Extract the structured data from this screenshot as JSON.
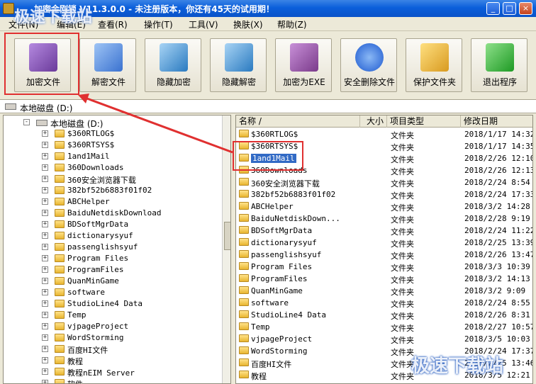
{
  "window": {
    "title": "加密金刚锁 V11.3.0.0 - 未注册版本，你还有45天的试用期！",
    "controls": [
      "_",
      "□",
      "×"
    ]
  },
  "menu": [
    "文件(N)",
    "编辑(E)",
    "查看(R)",
    "操作(T)",
    "工具(V)",
    "换肤(X)",
    "帮助(Z)"
  ],
  "toolbar": [
    {
      "label": "加密文件",
      "icon": "encrypt-book-icon",
      "color": "#7a4fb0"
    },
    {
      "label": "解密文件",
      "icon": "decrypt-key-icon",
      "color": "#4a7fd8"
    },
    {
      "label": "隐藏加密",
      "icon": "hide-lock-icon",
      "color": "#3a8ad0"
    },
    {
      "label": "隐藏解密",
      "icon": "unhide-key-icon",
      "color": "#3a8ad0"
    },
    {
      "label": "加密为EXE",
      "icon": "exe-lock-icon",
      "color": "#8a4a9a"
    },
    {
      "label": "安全删除文件",
      "icon": "delete-x-icon",
      "color": "#2a6ad8"
    },
    {
      "label": "保护文件夹",
      "icon": "protect-folder-icon",
      "color": "#d8a020"
    },
    {
      "label": "退出程序",
      "icon": "exit-arrow-icon",
      "color": "#2aa02a"
    }
  ],
  "address": "本地磁盘 (D:)",
  "tree": {
    "root": "本地磁盘 (D:)",
    "items": [
      "$360RTLOG$",
      "$360RTSYS$",
      "1and1Mail",
      "360Downloads",
      "360安全浏览器下载",
      "382bf52b6883f01f02",
      "ABCHelper",
      "BaiduNetdiskDownload",
      "BDSoftMgrData",
      "dictionarysyuf",
      "passenglishsyuf",
      "Program Files",
      "ProgramFiles",
      "QuanMinGame",
      "software",
      "StudioLine4 Data",
      "Temp",
      "vjpageProject",
      "WordStorming",
      "百度HI文件",
      "教程",
      "教程nEIM Server",
      "软件"
    ]
  },
  "list": {
    "columns": [
      "名称 /",
      "大小",
      "项目类型",
      "修改日期"
    ],
    "rows": [
      {
        "name": "$360RTLOG$",
        "type": "文件夹",
        "date": "2018/1/17 14:32"
      },
      {
        "name": "$360RTSYS$",
        "type": "文件夹",
        "date": "2018/1/17 14:35"
      },
      {
        "name": "1and1Mail",
        "type": "文件夹",
        "date": "2018/2/26 12:10"
      },
      {
        "name": "360Downloads",
        "type": "文件夹",
        "date": "2018/2/26 12:13"
      },
      {
        "name": "360安全浏览器下载",
        "type": "文件夹",
        "date": "2018/2/24 8:54"
      },
      {
        "name": "382bf52b6883f01f02",
        "type": "文件夹",
        "date": "2018/2/24 17:33"
      },
      {
        "name": "ABCHelper",
        "type": "文件夹",
        "date": "2018/3/2 14:28"
      },
      {
        "name": "BaiduNetdiskDown...",
        "type": "文件夹",
        "date": "2018/2/28 9:19"
      },
      {
        "name": "BDSoftMgrData",
        "type": "文件夹",
        "date": "2018/2/24 11:22"
      },
      {
        "name": "dictionarysyuf",
        "type": "文件夹",
        "date": "2018/2/25 13:39"
      },
      {
        "name": "passenglishsyuf",
        "type": "文件夹",
        "date": "2018/2/26 13:47"
      },
      {
        "name": "Program Files",
        "type": "文件夹",
        "date": "2018/3/3 10:39"
      },
      {
        "name": "ProgramFiles",
        "type": "文件夹",
        "date": "2018/3/2 14:13"
      },
      {
        "name": "QuanMinGame",
        "type": "文件夹",
        "date": "2018/3/2 9:09"
      },
      {
        "name": "software",
        "type": "文件夹",
        "date": "2018/2/24 8:55"
      },
      {
        "name": "StudioLine4 Data",
        "type": "文件夹",
        "date": "2018/2/26 8:31"
      },
      {
        "name": "Temp",
        "type": "文件夹",
        "date": "2018/2/27 10:57"
      },
      {
        "name": "vjpageProject",
        "type": "文件夹",
        "date": "2018/3/5 10:03"
      },
      {
        "name": "WordStorming",
        "type": "文件夹",
        "date": "2018/2/24 17:37"
      },
      {
        "name": "百度HI文件",
        "type": "文件夹",
        "date": "2018/2/25 13:46"
      },
      {
        "name": "教程",
        "type": "文件夹",
        "date": "2018/3/5 12:21"
      }
    ],
    "selected": "1and1Mail"
  },
  "watermark": {
    "top": "极速下载站",
    "bottom": "极速下载站"
  },
  "colors": {
    "highlight": "#e03030",
    "selection": "#316ac5",
    "titlebar": "#0b5fdb"
  }
}
